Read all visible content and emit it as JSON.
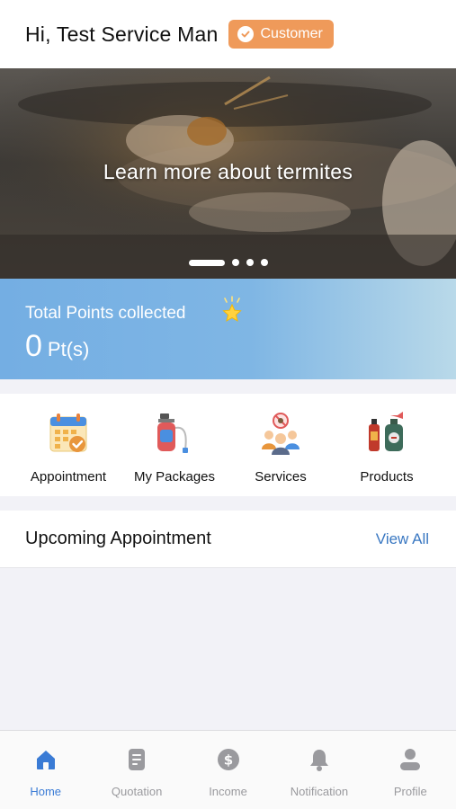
{
  "header": {
    "greeting": "Hi, Test Service Man",
    "role_badge": "Customer"
  },
  "banner": {
    "text": "Learn more about termites",
    "slide_count": 4,
    "active_slide": 1
  },
  "points": {
    "label": "Total Points collected",
    "value": "0",
    "unit": "Pt(s)"
  },
  "quick_menu": {
    "items": [
      {
        "label": "Appointment",
        "icon": "calendar-check-icon"
      },
      {
        "label": "My Packages",
        "icon": "sprayer-icon"
      },
      {
        "label": "Services",
        "icon": "people-pest-icon"
      },
      {
        "label": "Products",
        "icon": "spray-bottles-icon"
      }
    ]
  },
  "upcoming": {
    "title": "Upcoming Appointment",
    "view_all": "View All"
  },
  "bottom_nav": {
    "items": [
      {
        "label": "Home",
        "icon": "home-icon",
        "active": true
      },
      {
        "label": "Quotation",
        "icon": "document-icon",
        "active": false
      },
      {
        "label": "Income",
        "icon": "dollar-icon",
        "active": false
      },
      {
        "label": "Notification",
        "icon": "bell-icon",
        "active": false
      },
      {
        "label": "Profile",
        "icon": "user-icon",
        "active": false
      }
    ]
  },
  "colors": {
    "badge": "#ef9a5a",
    "accent": "#3a7bd5",
    "points_gradient_start": "#74aee3",
    "points_gradient_end": "#b9d9e9"
  }
}
